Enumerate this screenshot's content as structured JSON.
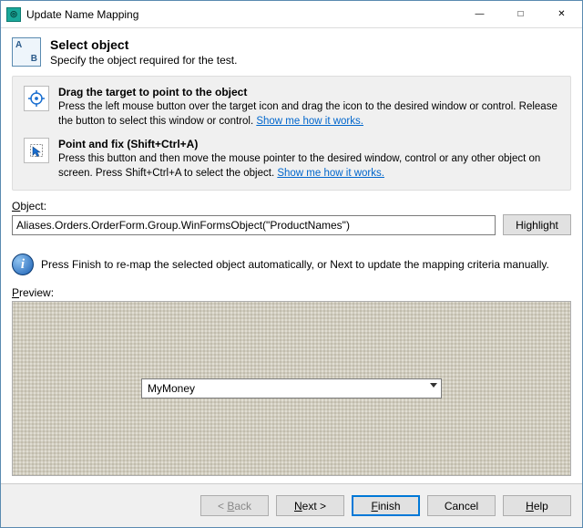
{
  "window": {
    "title": "Update Name Mapping"
  },
  "header": {
    "title": "Select object",
    "subtitle": "Specify the object required for the test."
  },
  "instructions": {
    "drag": {
      "title": "Drag the target to point to the object",
      "text_a": "Press the left mouse button over the target icon and drag the icon to the desired window or control. Release the button to select this window or control. ",
      "link": "Show me how it works."
    },
    "pointfix": {
      "title": "Point and fix (Shift+Ctrl+A)",
      "text_a": "Press this button and then move the mouse pointer to the desired window, control or any other object on screen. Press Shift+Ctrl+A to select the object. ",
      "link": "Show me how it works."
    }
  },
  "object": {
    "label": "Object:",
    "value": "Aliases.Orders.OrderForm.Group.WinFormsObject(\"ProductNames\")",
    "highlight": "Highlight"
  },
  "info": {
    "text": "Press Finish to re-map the selected object automatically, or Next to update the mapping criteria manually."
  },
  "preview": {
    "label": "Preview:",
    "combo_value": "MyMoney"
  },
  "footer": {
    "back": "< Back",
    "next": "Next >",
    "finish": "Finish",
    "cancel": "Cancel",
    "help": "Help"
  }
}
